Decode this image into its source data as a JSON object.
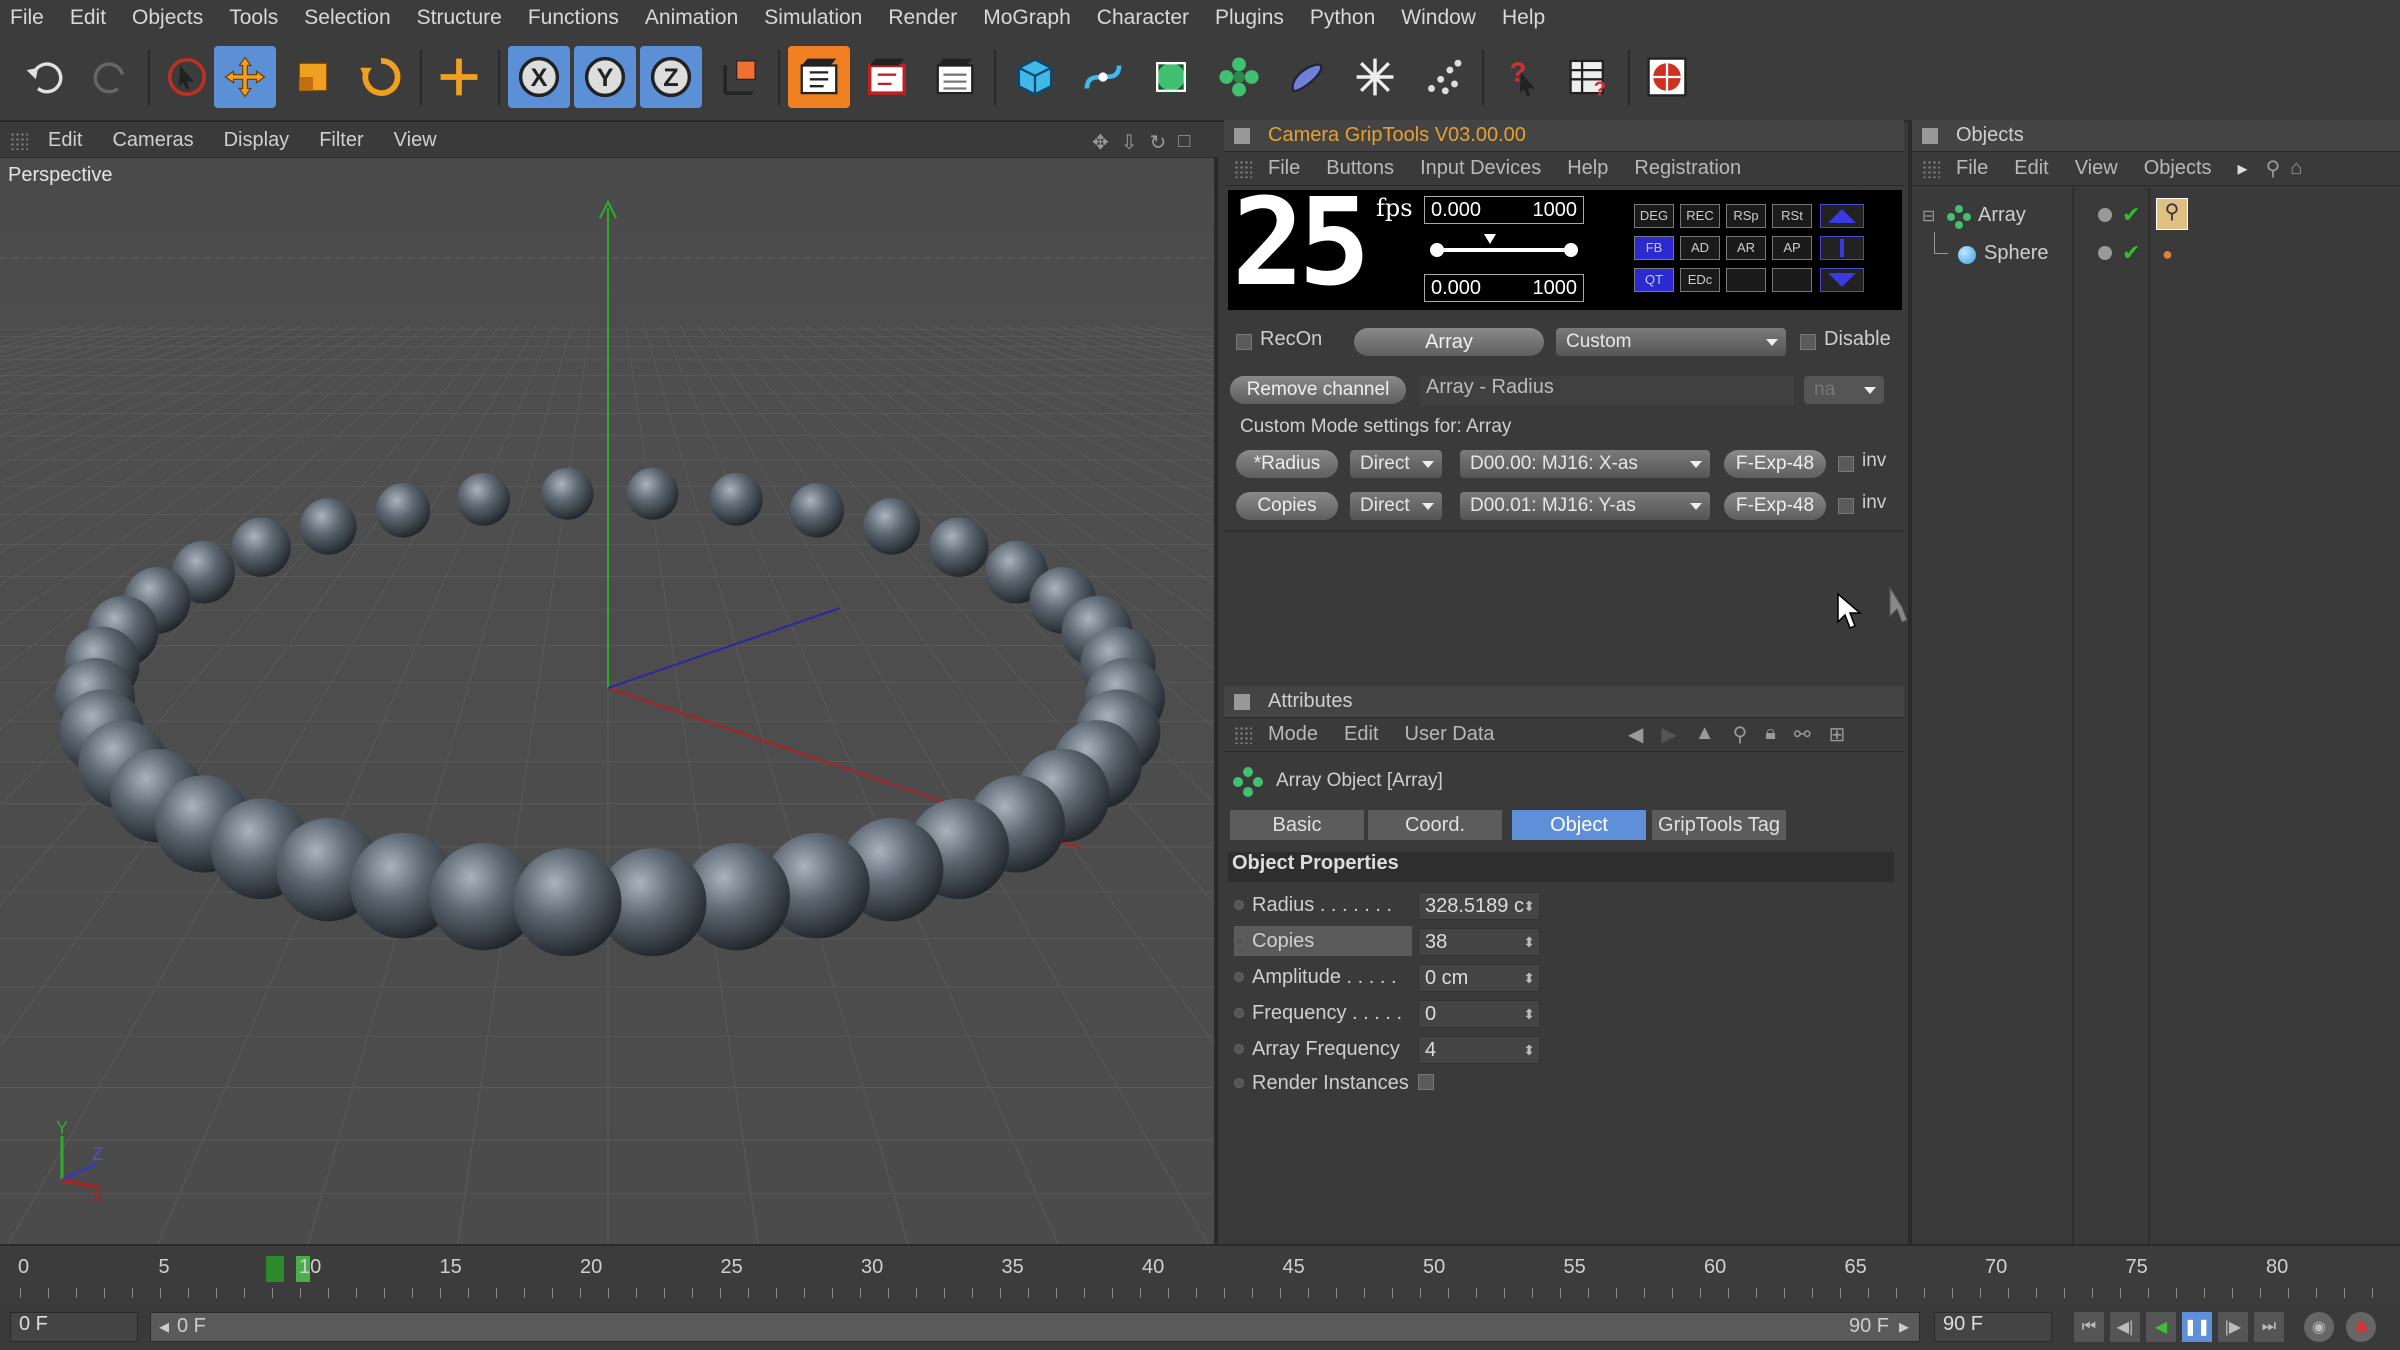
{
  "menu": [
    "File",
    "Edit",
    "Objects",
    "Tools",
    "Selection",
    "Structure",
    "Functions",
    "Animation",
    "Simulation",
    "Render",
    "MoGraph",
    "Character",
    "Plugins",
    "Python",
    "Window",
    "Help"
  ],
  "toolbar_icons": [
    "undo-icon",
    "redo-icon",
    "live-selection-icon",
    "move-icon",
    "scale-icon",
    "rotate-icon",
    "world-axis-icon",
    "x-axis-lock-icon",
    "y-axis-lock-icon",
    "z-axis-lock-icon",
    "coordinate-system-icon",
    "render-view-icon",
    "render-to-picture-viewer-icon",
    "render-settings-icon",
    "cube-icon",
    "spline-icon",
    "nurbs-icon",
    "array-icon",
    "deformer-icon",
    "environment-icon",
    "particles-icon",
    "help-pointer-icon",
    "scene-table-icon",
    "griptools-icon"
  ],
  "viewport": {
    "menu": [
      "Edit",
      "Cameras",
      "Display",
      "Filter",
      "View"
    ],
    "label": "Perspective",
    "axis_labels": {
      "y": "Y",
      "z": "Z",
      "x": "X"
    }
  },
  "griptools": {
    "title": "Camera GripTools V03.00.00",
    "menu": [
      "File",
      "Buttons",
      "Input Devices",
      "Help",
      "Registration"
    ],
    "fps_value": "25",
    "fps_label": "fps",
    "range_top": {
      "from": "0.000",
      "to": "1000"
    },
    "range_bottom": {
      "from": "0.000",
      "to": "1000"
    },
    "lcd_buttons_row1": [
      "DEG",
      "REC",
      "RSp",
      "RSt"
    ],
    "lcd_buttons_row2": [
      "FB",
      "AD",
      "AR",
      "AP"
    ],
    "lcd_buttons_row3": [
      "QT",
      "EDc",
      "",
      ""
    ],
    "recon_label": "RecOn",
    "array_button": "Array",
    "mode_dropdown": "Custom",
    "disable_label": "Disable",
    "remove_channel": "Remove channel",
    "channel_name": "Array - Radius",
    "na_dropdown": "na",
    "custom_mode_label": "Custom Mode settings for: Array",
    "rows": [
      {
        "param": "*Radius",
        "mode": "Direct",
        "device": "D00.00: MJ16: X-as",
        "curve": "F-Exp-48",
        "inv": "inv"
      },
      {
        "param": "Copies",
        "mode": "Direct",
        "device": "D00.01: MJ16: Y-as",
        "curve": "F-Exp-48",
        "inv": "inv"
      }
    ]
  },
  "attributes": {
    "title": "Attributes",
    "menu": [
      "Mode",
      "Edit",
      "User Data"
    ],
    "object_title": "Array Object [Array]",
    "tabs": [
      "Basic",
      "Coord.",
      "Object",
      "GripTools Tag"
    ],
    "active_tab": "Object",
    "section": "Object Properties",
    "props": [
      {
        "label": "Radius . . . . . . .",
        "value": "328.5189 c"
      },
      {
        "label": "Copies",
        "value": "38"
      },
      {
        "label": "Amplitude . . . . .",
        "value": "0 cm"
      },
      {
        "label": "Frequency . . . . .",
        "value": "0"
      },
      {
        "label": "Array Frequency",
        "value": "4"
      },
      {
        "label": "Render Instances",
        "value": ""
      }
    ]
  },
  "objects": {
    "title": "Objects",
    "menu": [
      "File",
      "Edit",
      "View",
      "Objects"
    ],
    "items": [
      {
        "name": "Array"
      },
      {
        "name": "Sphere"
      }
    ]
  },
  "timeline": {
    "ticks": [
      "0",
      "5",
      "10",
      "15",
      "20",
      "25",
      "30",
      "35",
      "40",
      "45",
      "50",
      "55",
      "60",
      "65",
      "70",
      "75",
      "80"
    ],
    "current_frame": "0 F",
    "range_start": "0 F",
    "range_end": "90 F",
    "end_frame": "90 F"
  },
  "colors": {
    "accent_blue": "#5f8fd8",
    "accent_orange": "#f08020",
    "title_orange": "#e8a030",
    "sphere": "#5d6873"
  }
}
